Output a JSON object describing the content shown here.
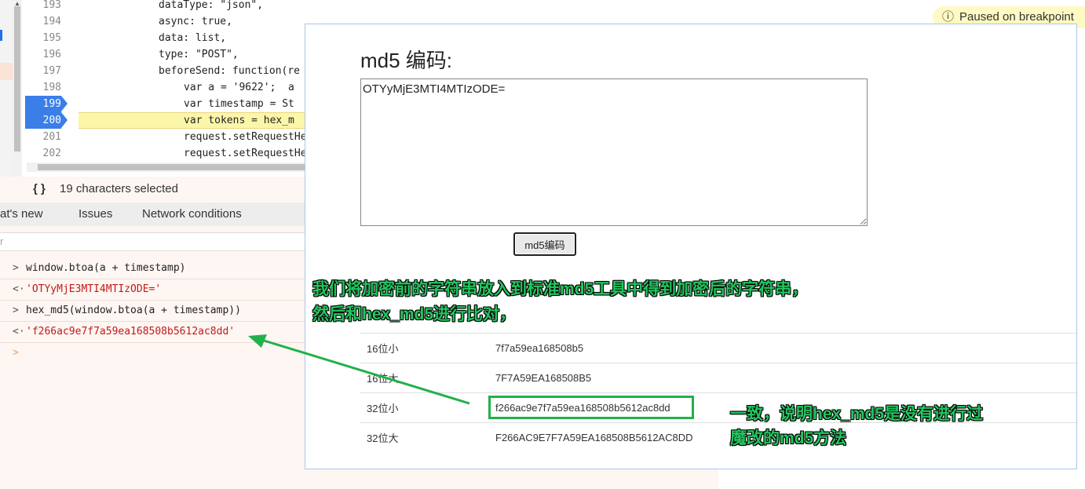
{
  "editor": {
    "lines": [
      {
        "num": "193",
        "code": "dataType: \"json\","
      },
      {
        "num": "194",
        "code": "async: true,"
      },
      {
        "num": "195",
        "code": "data: list,"
      },
      {
        "num": "196",
        "code": "type: \"POST\","
      },
      {
        "num": "197",
        "code": "beforeSend: function(re"
      },
      {
        "num": "198",
        "code": "var a = '9622';  a"
      },
      {
        "num": "199",
        "code": "var timestamp = St"
      },
      {
        "num": "200",
        "code": "var tokens = hex_m"
      },
      {
        "num": "201",
        "code": "request.setRequestHe"
      },
      {
        "num": "202",
        "code": "request.setRequestHe"
      }
    ],
    "status_text": "19 characters selected",
    "braces_icon": "{ }"
  },
  "tabs": {
    "whats_new": "at's new",
    "issues": "Issues",
    "network": "Network conditions"
  },
  "filter_placeholder": "r",
  "console": {
    "lines": [
      {
        "prefix": ">",
        "text": "window.btoa(a + timestamp)",
        "color": "#222222"
      },
      {
        "prefix": "<·",
        "text": "'OTYyMjE3MTI4MTIzODE='",
        "color": "#c41a16"
      },
      {
        "prefix": ">",
        "text": "hex_md5(window.btoa(a + timestamp))",
        "color": "#222222"
      },
      {
        "prefix": "<·",
        "text": "'f266ac9e7f7a59ea168508b5612ac8dd'",
        "color": "#c41a16"
      },
      {
        "prefix": ">",
        "text": "",
        "color": "#222222"
      }
    ]
  },
  "paused_label": "Paused on breakpoint",
  "md5_tool": {
    "title": "md5 编码:",
    "input_value": "OTYyMjE3MTI4MTIzODE=",
    "button_label": "md5编码",
    "results": [
      {
        "key": "16位小",
        "value": "7f7a59ea168508b5"
      },
      {
        "key": "16位大",
        "value": "7F7A59EA168508B5"
      },
      {
        "key": "32位小",
        "value": "f266ac9e7f7a59ea168508b5612ac8dd"
      },
      {
        "key": "32位大",
        "value": "F266AC9E7F7A59EA168508B5612AC8DD"
      }
    ]
  },
  "annotations": {
    "top_line1": "我们将加密前的字符串放入到标准md5工具中得到加密后的字符串，",
    "top_line2": "然后和hex_md5进行比对，",
    "right_line1": "一致，说明hex_md5是没有进行过",
    "right_line2": "魔改的md5方法"
  },
  "colors": {
    "annotation": "#22c55e",
    "breakpoint": "#3b7ee8",
    "highlight_line": "#fcf6a8",
    "console_string": "#c41a16"
  }
}
